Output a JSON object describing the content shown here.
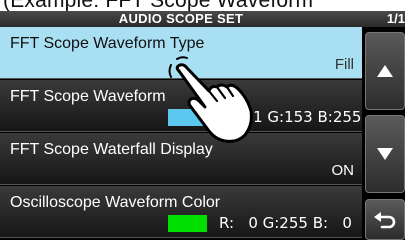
{
  "caption": "(Example: FFT Scope Waveform",
  "header": {
    "title": "AUDIO SCOPE SET",
    "page": "1/1"
  },
  "menu": {
    "items": [
      {
        "label": "FFT Scope Waveform Type",
        "value": "Fill"
      },
      {
        "label": "FFT Scope Waveform",
        "color": "#5cc8f0",
        "rgb_text": "R:  51 G:153 B:255"
      },
      {
        "label": "FFT Scope Waterfall Display",
        "value": "ON"
      },
      {
        "label": "Oscilloscope Waveform Color",
        "color": "#00e000",
        "rgb_text": "R:   0 G:255 B:   0"
      }
    ]
  },
  "buttons": {
    "up": "up-arrow-icon",
    "down": "down-arrow-icon",
    "back": "return-icon"
  }
}
